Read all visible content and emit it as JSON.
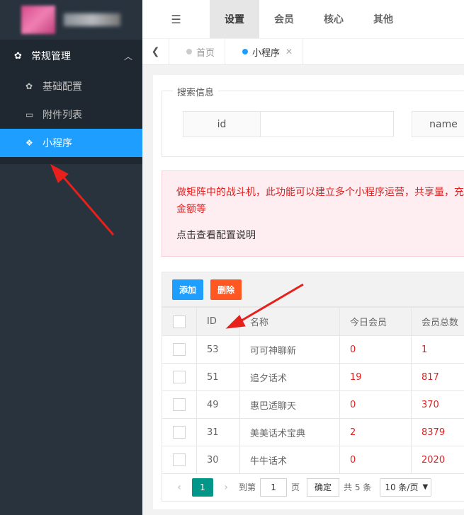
{
  "sidebar": {
    "group": {
      "label": "常规管理",
      "icon": "gear-icon",
      "arrow": "chevron-up-icon"
    },
    "items": [
      {
        "label": "基础配置",
        "icon": "gear-icon"
      },
      {
        "label": "附件列表",
        "icon": "folder-icon"
      },
      {
        "label": "小程序",
        "icon": "cube-icon",
        "active": true
      }
    ]
  },
  "header": {
    "tabs": [
      {
        "label": "设置",
        "active": true
      },
      {
        "label": "会员"
      },
      {
        "label": "核心"
      },
      {
        "label": "其他"
      }
    ]
  },
  "tabbar": {
    "tabs": [
      {
        "label": "首页"
      },
      {
        "label": "小程序",
        "active": true
      }
    ]
  },
  "search": {
    "legend": "搜索信息",
    "id_label": "id",
    "name_label": "name"
  },
  "alert": {
    "text": "做矩阵中的战斗机，此功能可以建立多个小程序运营，共享量，充值金额等",
    "link": "点击查看配置说明"
  },
  "toolbar": {
    "add_label": "添加",
    "delete_label": "删除"
  },
  "table": {
    "headers": [
      "ID",
      "名称",
      "今日会员",
      "会员总数"
    ],
    "rows": [
      {
        "id": "53",
        "name": "可可神聊新",
        "today": "0",
        "total": "1"
      },
      {
        "id": "51",
        "name": "追夕话术",
        "today": "19",
        "total": "817"
      },
      {
        "id": "49",
        "name": "惠巴适聊天",
        "today": "0",
        "total": "370"
      },
      {
        "id": "31",
        "name": "美美话术宝典",
        "today": "2",
        "total": "8379"
      },
      {
        "id": "30",
        "name": "牛牛话术",
        "today": "0",
        "total": "2020"
      }
    ]
  },
  "pager": {
    "current": "1",
    "goto_label": "到第",
    "goto_value": "1",
    "page_unit": "页",
    "confirm": "确定",
    "total": "共 5 条",
    "page_size": "10 条/页"
  },
  "colors": {
    "active_blue": "#1e9fff",
    "danger": "#ff5722",
    "pager_green": "#009688",
    "sidebar_bg": "#28333e"
  }
}
